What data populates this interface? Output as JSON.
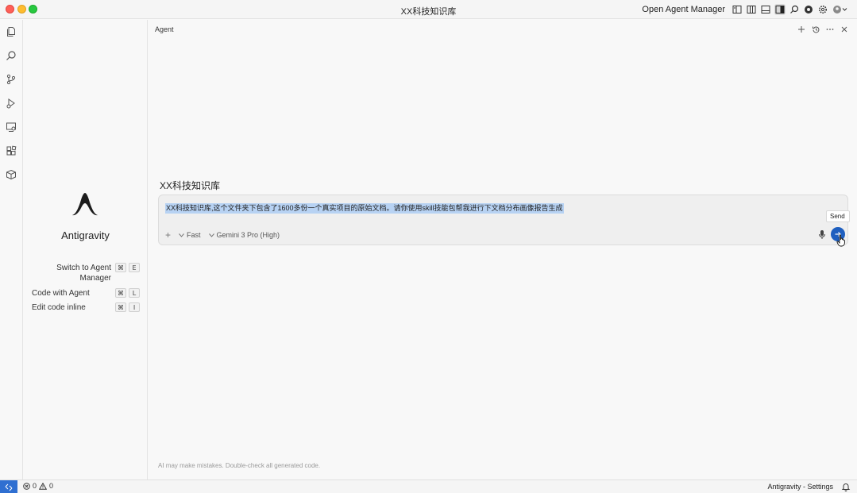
{
  "window": {
    "title": "XX科技知识库",
    "open_agent_manager": "Open Agent Manager"
  },
  "sidepanel": {
    "brand": "Antigravity",
    "shortcuts": [
      {
        "label_line1": "Switch to Agent",
        "label_line2": "Manager",
        "mod": "⌘",
        "key": "E"
      },
      {
        "label_line1": "Code with Agent",
        "label_line2": "",
        "mod": "⌘",
        "key": "L"
      },
      {
        "label_line1": "Edit code inline",
        "label_line2": "",
        "mod": "⌘",
        "key": "I"
      }
    ]
  },
  "agent": {
    "panel_title": "Agent",
    "kb_title": "XX科技知识库",
    "prompt": "XX科技知识库,这个文件夹下包含了1600多份一个真实项目的原始文档。请你使用skill技能包帮我进行下文档分布画像报告生成",
    "mode": "Fast",
    "model": "Gemini 3 Pro (High)",
    "tooltip": "Send",
    "disclaimer": "AI may make mistakes. Double-check all generated code."
  },
  "statusbar": {
    "errors": "0",
    "warnings": "0",
    "right_text": "Antigravity - Settings"
  },
  "colors": {
    "accent": "#1f5fbf",
    "selection": "#b7d2f3",
    "remote": "#2f6fd1"
  }
}
